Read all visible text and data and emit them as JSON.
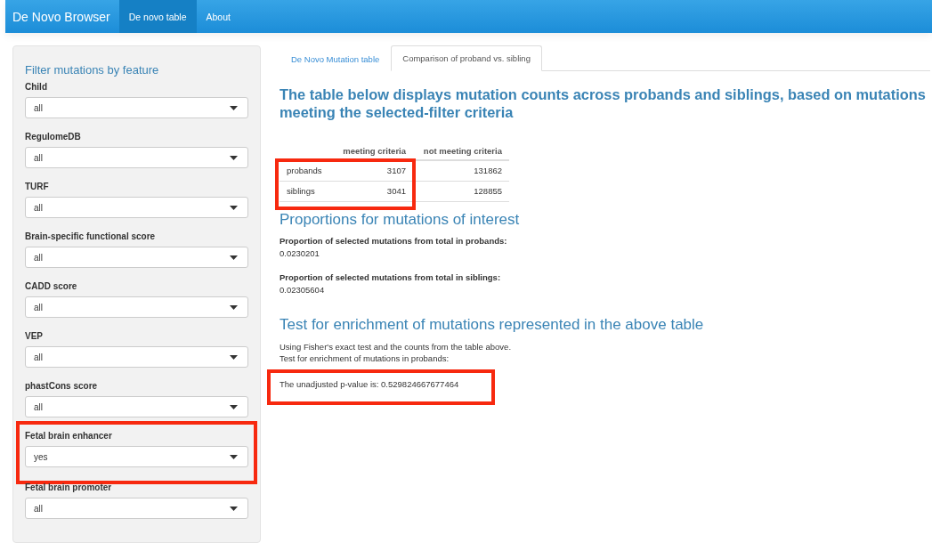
{
  "navbar": {
    "brand": "De Novo Browser",
    "items": [
      {
        "label": "De novo table",
        "selected": true
      },
      {
        "label": "About",
        "selected": false
      }
    ]
  },
  "sidebar": {
    "title": "Filter mutations by feature",
    "filters": [
      {
        "label": "Child",
        "value": "all",
        "highlighted": false
      },
      {
        "label": "RegulomeDB",
        "value": "all",
        "highlighted": false
      },
      {
        "label": "TURF",
        "value": "all",
        "highlighted": false
      },
      {
        "label": "Brain-specific functional score",
        "value": "all",
        "highlighted": false
      },
      {
        "label": "CADD score",
        "value": "all",
        "highlighted": false
      },
      {
        "label": "VEP",
        "value": "all",
        "highlighted": false
      },
      {
        "label": "phastCons score",
        "value": "all",
        "highlighted": false
      },
      {
        "label": "Fetal brain enhancer",
        "value": "yes",
        "highlighted": true
      },
      {
        "label": "Fetal brain promoter",
        "value": "all",
        "highlighted": false
      }
    ]
  },
  "tabs": [
    {
      "label": "De Novo Mutation table",
      "selected": false
    },
    {
      "label": "Comparison of proband vs. sibling",
      "selected": true
    }
  ],
  "heading": "The table below displays mutation counts across probands and siblings, based on mutations meeting the selected-filter criteria",
  "table": {
    "columns": [
      "",
      "meeting criteria",
      "not meeting criteria"
    ],
    "highlight_box": true,
    "rows": [
      {
        "cells": [
          "probands",
          "3107",
          "131862"
        ]
      },
      {
        "cells": [
          "siblings",
          "3041",
          "128855"
        ]
      }
    ]
  },
  "proportions": {
    "title": "Proportions for mutations of interest",
    "items": [
      {
        "label": "Proportion of selected mutations from total in probands:",
        "value": "0.0230201"
      },
      {
        "label": "Proportion of selected mutations from total in siblings:",
        "value": "0.02305604"
      }
    ]
  },
  "test": {
    "title": "Test for enrichment of mutations represented in the above table",
    "lines": [
      "Using Fisher's exact test and the counts from the table above.",
      "Test for enrichment of mutations in probands:"
    ],
    "result": "The unadjusted p-value is: 0.529824667677464",
    "result_highlighted": true
  }
}
